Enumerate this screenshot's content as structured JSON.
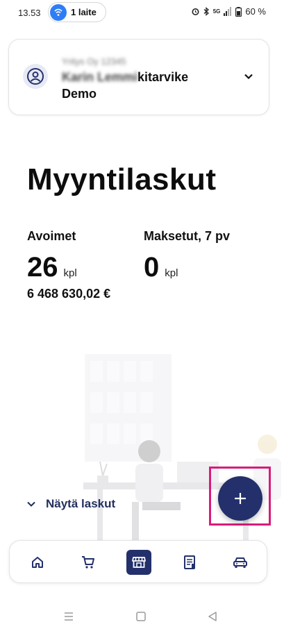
{
  "status_bar": {
    "time": "13.53",
    "hotspot_label": "1 laite",
    "network": "5G",
    "battery": "60 %"
  },
  "company": {
    "subtitle": "Yritys Oy 12345",
    "name_prefix": "Karin Lemmi",
    "name_suffix": "kitarvike",
    "name_line2": "Demo"
  },
  "page": {
    "title": "Myyntilaskut"
  },
  "stats": {
    "open": {
      "label": "Avoimet",
      "count": "26",
      "unit": "kpl",
      "sum": "6 468 630,02 €"
    },
    "paid": {
      "label": "Maksetut, 7 pv",
      "count": "0",
      "unit": "kpl"
    }
  },
  "actions": {
    "show_invoices": "Näytä laskut"
  },
  "bottom_nav": {
    "items": [
      {
        "icon": "home-icon"
      },
      {
        "icon": "cart-icon"
      },
      {
        "icon": "store-icon",
        "active": true
      },
      {
        "icon": "receipt-icon"
      },
      {
        "icon": "car-icon"
      }
    ]
  },
  "colors": {
    "primary": "#23306b",
    "highlight": "#d81b7a",
    "hotspot": "#2f7df6"
  }
}
